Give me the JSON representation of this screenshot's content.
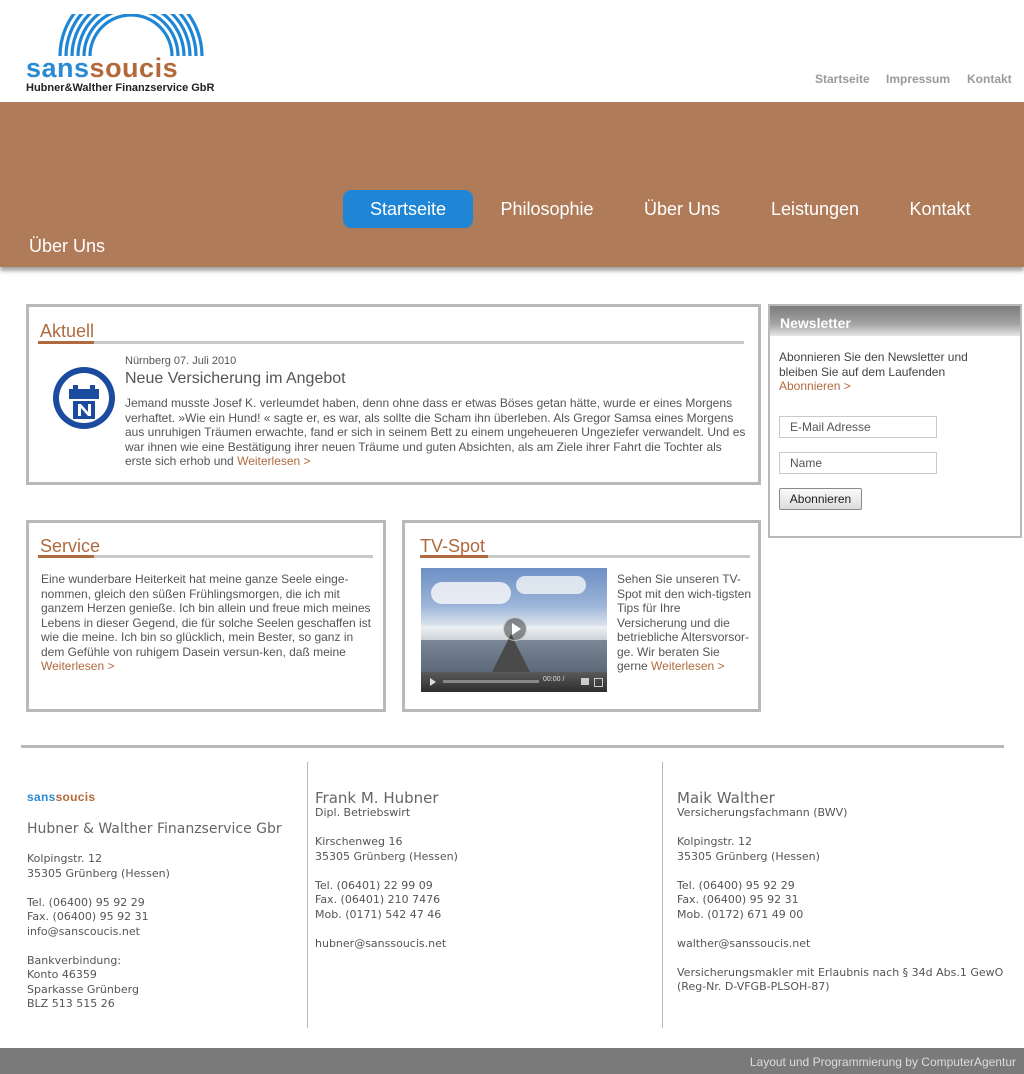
{
  "header": {
    "logo": {
      "brand_a": "sans",
      "brand_b": "soucis",
      "subtitle": "Hubner&Walther Finanzservice GbR"
    },
    "top_links": [
      "Startseite",
      "Impressum",
      "Kontakt"
    ]
  },
  "nav": {
    "items": [
      "Startseite",
      "Philosophie",
      "Über Uns",
      "Leistungen",
      "Kontakt"
    ],
    "active": "Startseite",
    "page_title": "Über Uns"
  },
  "aktuell": {
    "title": "Aktuell",
    "date": "Nürnberg 07. Juli 2010",
    "headline": "Neue Versicherung im Angebot",
    "body": "Jemand musste Josef K. verleumdet haben, denn ohne dass er etwas Böses getan hätte, wurde er eines Morgens verhaftet. »Wie ein Hund! « sagte er, es war, als sollte die Scham ihn überleben. Als Gregor Samsa eines Morgens aus unruhigen Träumen erwachte, fand er sich in seinem Bett zu einem ungeheueren Ungeziefer verwandelt. Und es war ihnen wie eine Bestätigung ihrer neuen Träume und guten Absichten, als am Ziele ihrer Fahrt die Tochter als erste sich erhob und",
    "more": "Weiterlesen >"
  },
  "service": {
    "title": "Service",
    "body": "Eine wunderbare Heiterkeit hat meine ganze Seele einge-nommen, gleich den süßen Frühlingsmorgen, die ich mit ganzem Herzen genieße. Ich bin allein und freue mich meines Lebens in dieser Gegend, die für solche Seelen geschaffen ist wie die meine. Ich bin so glücklich, mein Bester, so ganz in dem Gefühle von ruhigem Dasein versun-ken, daß meine",
    "more": "Weiterlesen >"
  },
  "tvspot": {
    "title": "TV-Spot",
    "body": "Sehen Sie unseren TV-Spot mit den wich-tigsten Tips für Ihre Versicherung und die betriebliche Altersvorsor-ge. Wir beraten Sie gerne",
    "more": "Weiterlesen >",
    "video_time": "00:00 / "
  },
  "newsletter": {
    "title": "Newsletter",
    "text": "Abonnieren Sie den Newsletter und bleiben Sie auf dem Laufenden",
    "link": "Abonnieren >",
    "email_placeholder": "E-Mail Adresse",
    "name_placeholder": "Name",
    "button": "Abonnieren"
  },
  "footer": {
    "col1": {
      "logo_a": "sans",
      "logo_b": "soucis",
      "company": "Hubner & Walther Finanzservice Gbr",
      "street": "Kolpingstr. 12",
      "city": "35305 Grünberg (Hessen)",
      "tel": "Tel. (06400) 95 92 29",
      "fax": "Fax. (06400) 95 92 31",
      "email": "info@sanscoucis.net",
      "bank_label": "Bankverbindung:",
      "konto": "Konto 46359",
      "bank": "Sparkasse Grünberg",
      "blz": "BLZ 513 515 26"
    },
    "col2": {
      "name": "Frank M. Hubner",
      "role": "Dipl. Betriebswirt",
      "street": "Kirschenweg 16",
      "city": "35305 Grünberg (Hessen)",
      "tel": "Tel. (06401) 22 99 09",
      "fax": "Fax. (06401) 210 7476",
      "mob": "Mob. (0171) 542 47 46",
      "email": "hubner@sanssoucis.net"
    },
    "col3": {
      "name": "Maik Walther",
      "role": "Versicherungsfachmann (BWV)",
      "street": "Kolpingstr. 12",
      "city": "35305 Grünberg (Hessen)",
      "tel": "Tel. (06400) 95 92 29",
      "fax": "Fax. (06400) 95 92 31",
      "mob": "Mob. (0172) 671 49 00",
      "email": "walther@sanssoucis.net",
      "legal1": "Versicherungsmakler mit Erlaubnis nach § 34d Abs.1 GewO",
      "legal2": "(Reg-Nr. D-VFGB-PLSOH-87)"
    },
    "credit": "Layout und Programmierung by ComputerAgentur"
  },
  "colors": {
    "brown": "#b07b59",
    "accent": "#b06a3e",
    "blue": "#1f86d6"
  },
  "icons": [
    "logo-arcs-icon",
    "emblem-icon",
    "play-icon"
  ]
}
